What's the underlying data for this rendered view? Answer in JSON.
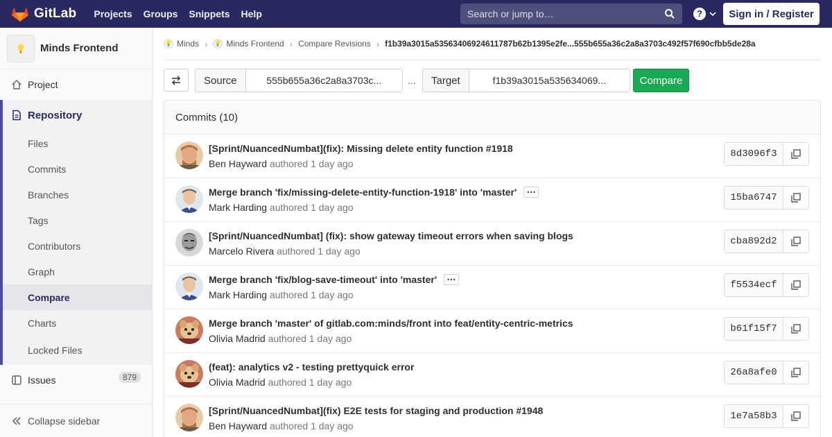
{
  "nav": {
    "brand": "GitLab",
    "links": [
      "Projects",
      "Groups",
      "Snippets",
      "Help"
    ],
    "search_placeholder": "Search or jump to…",
    "help_icon": "?",
    "signin_label": "Sign in / Register",
    "brand_color": "#292961"
  },
  "sidebar": {
    "project_name": "Minds Frontend",
    "project_label": "Project",
    "repository_label": "Repository",
    "repo_items": [
      "Files",
      "Commits",
      "Branches",
      "Tags",
      "Contributors",
      "Graph",
      "Compare",
      "Charts",
      "Locked Files"
    ],
    "active_item": "Compare",
    "issues_label": "Issues",
    "issues_count": "879",
    "collapse_label": "Collapse sidebar"
  },
  "breadcrumb": {
    "items": [
      "Minds",
      "Minds Frontend",
      "Compare Revisions"
    ],
    "current": "f1b39a3015a53563406924611787b62b1395e2fe...555b655a36c2a8a3703c492f57f690cfbb5de28a"
  },
  "compare": {
    "source_label": "Source",
    "source_value": "555b655a36c2a8a3703c...",
    "separator": "...",
    "target_label": "Target",
    "target_value": "f1b39a3015a535634069...",
    "compare_label": "Compare"
  },
  "commits": {
    "header": "Commits (10)",
    "rows": [
      {
        "title": "[Sprint/NuancedNumbat](fix): Missing delete entity function #1918",
        "author": "Ben Hayward",
        "authored": "authored 1 day ago",
        "sha": "8d3096f3",
        "merge": false,
        "avatar": "ben"
      },
      {
        "title": "Merge branch 'fix/missing-delete-entity-function-1918' into 'master'",
        "author": "Mark Harding",
        "authored": "authored 1 day ago",
        "sha": "15ba6747",
        "merge": true,
        "avatar": "mark"
      },
      {
        "title": "[Sprint/NuancedNumbat] (fix): show gateway timeout errors when saving blogs",
        "author": "Marcelo Rivera",
        "authored": "authored 1 day ago",
        "sha": "cba892d2",
        "merge": false,
        "avatar": "marcelo"
      },
      {
        "title": "Merge branch 'fix/blog-save-timeout' into 'master'",
        "author": "Mark Harding",
        "authored": "authored 1 day ago",
        "sha": "f5534ecf",
        "merge": true,
        "avatar": "mark"
      },
      {
        "title": "Merge branch 'master' of gitlab.com:minds/front into feat/entity-centric-metrics",
        "author": "Olivia Madrid",
        "authored": "authored 1 day ago",
        "sha": "b61f15f7",
        "merge": false,
        "avatar": "olivia"
      },
      {
        "title": "(feat): analytics v2 - testing prettyquick error",
        "author": "Olivia Madrid",
        "authored": "authored 1 day ago",
        "sha": "26a8afe0",
        "merge": false,
        "avatar": "olivia"
      },
      {
        "title": "[Sprint/NuancedNumbat](fix) E2E tests for staging and production #1948",
        "author": "Ben Hayward",
        "authored": "authored 1 day ago",
        "sha": "1e7a58b3",
        "merge": false,
        "avatar": "ben"
      }
    ]
  }
}
